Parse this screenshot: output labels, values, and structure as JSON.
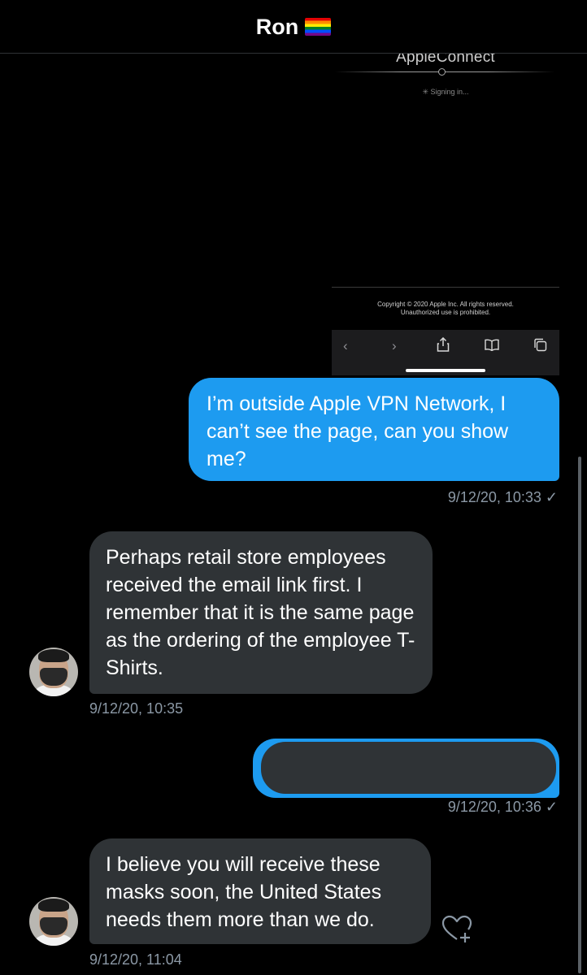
{
  "header": {
    "title": "Ron",
    "flag_icon": "rainbow-flag-icon"
  },
  "shared_image": {
    "app_title": "AppleConnect",
    "status": "Signing in...",
    "copyright_line1": "Copyright © 2020 Apple Inc. All rights reserved.",
    "copyright_line2": "Unauthorized use is prohibited.",
    "toolbar_icons": [
      "back-icon",
      "forward-icon",
      "share-icon",
      "bookmarks-icon",
      "tabs-icon"
    ]
  },
  "messages": [
    {
      "direction": "out",
      "text": "I’m outside Apple VPN Network, I can’t see the page, can you show me?",
      "timestamp": "9/12/20, 10:33 ✓"
    },
    {
      "direction": "in",
      "text": "Perhaps retail store employees received the email link first. I remember that it is the same page as the ordering of the employee T-Shirts.",
      "timestamp": "9/12/20, 10:35"
    },
    {
      "direction": "out",
      "text": "",
      "redacted": true,
      "timestamp": "9/12/20, 10:36 ✓"
    },
    {
      "direction": "in",
      "text": "I believe you will receive these masks soon, the United States needs them more than we do.",
      "timestamp": "9/12/20, 11:04"
    }
  ],
  "colors": {
    "outgoing_bubble": "#1d9bf0",
    "incoming_bubble": "#2f3336",
    "background": "#000000"
  }
}
